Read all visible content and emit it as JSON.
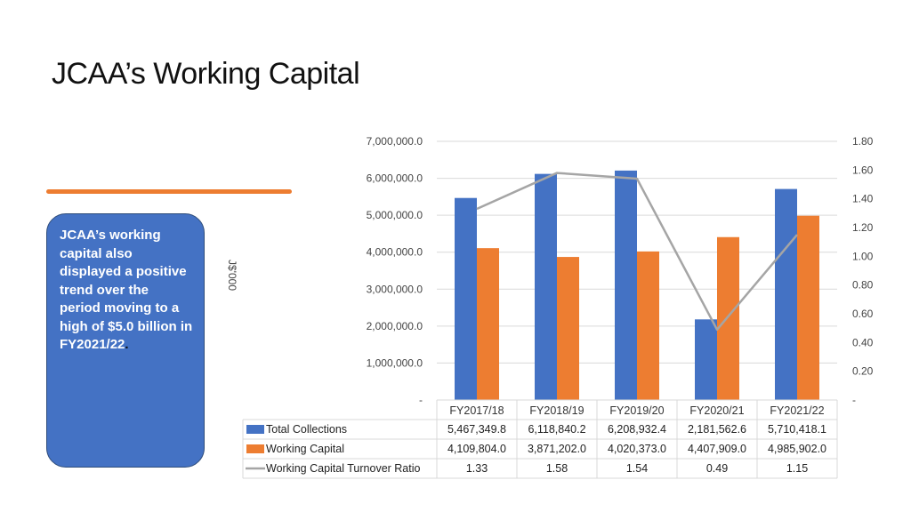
{
  "page": {
    "title": "JCAA’s Working Capital",
    "accent_color": "#ed7d31",
    "callout": {
      "text_main": "JCAA’s working capital also displayed a positive trend over the period moving to a high of $5.0 billion in FY2021/22",
      "text_end": ".",
      "bg_color": "#4472c4"
    }
  },
  "chart_data": {
    "type": "bar",
    "ylabel": "J$'000",
    "categories": [
      "FY2017/18",
      "FY2018/19",
      "FY2019/20",
      "FY2020/21",
      "FY2021/22"
    ],
    "series": [
      {
        "name": "Total Collections",
        "type": "bar",
        "axis": "primary",
        "color": "#4472c4",
        "values": [
          5467349.8,
          6118840.2,
          6208932.4,
          2181562.6,
          5710418.1
        ],
        "labels": [
          "5,467,349.8",
          "6,118,840.2",
          "6,208,932.4",
          "2,181,562.6",
          "5,710,418.1"
        ]
      },
      {
        "name": "Working Capital",
        "type": "bar",
        "axis": "primary",
        "color": "#ed7d31",
        "values": [
          4109804.0,
          3871202.0,
          4020373.0,
          4407909.0,
          4985902.0
        ],
        "labels": [
          "4,109,804.0",
          "3,871,202.0",
          "4,020,373.0",
          "4,407,909.0",
          "4,985,902.0"
        ]
      },
      {
        "name": "Working Capital Turnover Ratio",
        "type": "line",
        "axis": "secondary",
        "color": "#a5a5a5",
        "values": [
          1.33,
          1.58,
          1.54,
          0.49,
          1.15
        ],
        "labels": [
          "1.33",
          "1.58",
          "1.54",
          "0.49",
          "1.15"
        ]
      }
    ],
    "y_primary": {
      "ylim": [
        0,
        7000000
      ],
      "ticks": [
        0,
        1000000,
        2000000,
        3000000,
        4000000,
        5000000,
        6000000,
        7000000
      ],
      "tick_labels": [
        "-",
        "1,000,000.0",
        "2,000,000.0",
        "3,000,000.0",
        "4,000,000.0",
        "5,000,000.0",
        "6,000,000.0",
        "7,000,000.0"
      ]
    },
    "y_secondary": {
      "ylim": [
        0,
        1.8
      ],
      "ticks": [
        0,
        0.2,
        0.4,
        0.6,
        0.8,
        1.0,
        1.2,
        1.4,
        1.6,
        1.8
      ],
      "tick_labels": [
        "-",
        "0.20",
        "0.40",
        "0.60",
        "0.80",
        "1.00",
        "1.20",
        "1.40",
        "1.60",
        "1.80"
      ]
    },
    "grid": true,
    "data_table": true,
    "gridline_color": "#d9d9d9",
    "table_border_color": "#d9d9d9"
  }
}
